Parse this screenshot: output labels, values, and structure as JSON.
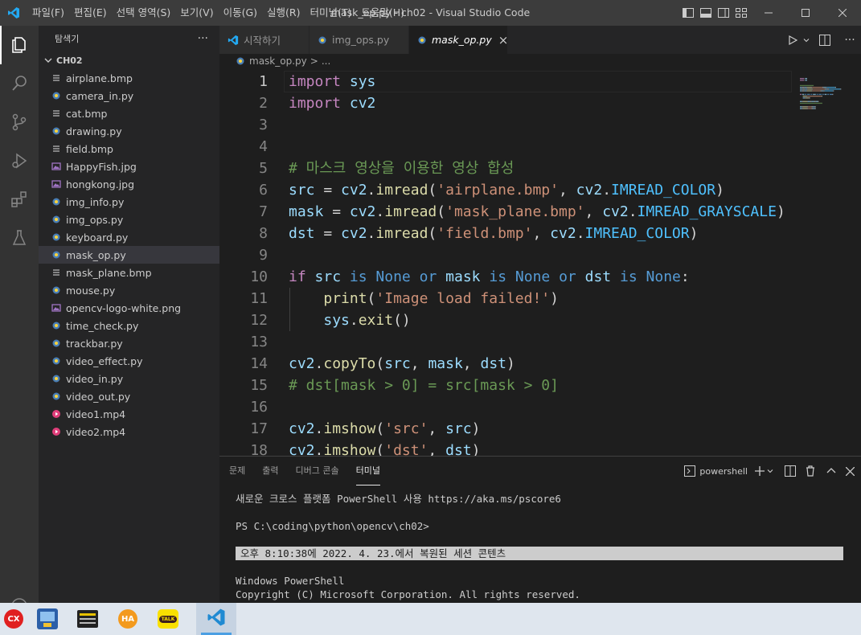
{
  "titlebar": {
    "menu": [
      "파일(F)",
      "편집(E)",
      "선택 영역(S)",
      "보기(V)",
      "이동(G)",
      "실행(R)",
      "터미널(T)",
      "도움말(H)"
    ],
    "title": "mask_op.py - ch02 - Visual Studio Code"
  },
  "sidebar": {
    "header": "탐색기",
    "more": "···",
    "folder": "CH02",
    "files": [
      {
        "name": "airplane.bmp",
        "icon": "bmp-file-icon"
      },
      {
        "name": "camera_in.py",
        "icon": "python-file-icon"
      },
      {
        "name": "cat.bmp",
        "icon": "bmp-file-icon"
      },
      {
        "name": "drawing.py",
        "icon": "python-file-icon"
      },
      {
        "name": "field.bmp",
        "icon": "bmp-file-icon"
      },
      {
        "name": "HappyFish.jpg",
        "icon": "image-file-icon"
      },
      {
        "name": "hongkong.jpg",
        "icon": "image-file-icon"
      },
      {
        "name": "img_info.py",
        "icon": "python-file-icon"
      },
      {
        "name": "img_ops.py",
        "icon": "python-file-icon"
      },
      {
        "name": "keyboard.py",
        "icon": "python-file-icon"
      },
      {
        "name": "mask_op.py",
        "icon": "python-file-icon",
        "selected": true
      },
      {
        "name": "mask_plane.bmp",
        "icon": "bmp-file-icon"
      },
      {
        "name": "mouse.py",
        "icon": "python-file-icon"
      },
      {
        "name": "opencv-logo-white.png",
        "icon": "image-file-icon"
      },
      {
        "name": "time_check.py",
        "icon": "python-file-icon"
      },
      {
        "name": "trackbar.py",
        "icon": "python-file-icon"
      },
      {
        "name": "video_effect.py",
        "icon": "python-file-icon"
      },
      {
        "name": "video_in.py",
        "icon": "python-file-icon"
      },
      {
        "name": "video_out.py",
        "icon": "python-file-icon"
      },
      {
        "name": "video1.mp4",
        "icon": "video-file-icon"
      },
      {
        "name": "video2.mp4",
        "icon": "video-file-icon"
      }
    ]
  },
  "tabs": [
    {
      "label": "시작하기",
      "icon": "vscode-icon"
    },
    {
      "label": "img_ops.py",
      "icon": "python-file-icon"
    },
    {
      "label": "mask_op.py",
      "icon": "python-file-icon",
      "active": true,
      "close": "×"
    }
  ],
  "breadcrumb": {
    "file": "mask_op.py",
    "sep": ">",
    "rest": "..."
  },
  "editor": {
    "line_numbers": [
      "1",
      "2",
      "3",
      "4",
      "5",
      "6",
      "7",
      "8",
      "9",
      "10",
      "11",
      "12",
      "13",
      "14",
      "15",
      "16",
      "17",
      "18"
    ],
    "lines": [
      [
        [
          "kw",
          "import"
        ],
        [
          "plain",
          " "
        ],
        [
          "var",
          "sys"
        ]
      ],
      [
        [
          "kw",
          "import"
        ],
        [
          "plain",
          " "
        ],
        [
          "var",
          "cv2"
        ]
      ],
      [],
      [],
      [
        [
          "cmt",
          "# 마스크 영상을 이용한 영상 합성"
        ]
      ],
      [
        [
          "var",
          "src"
        ],
        [
          "plain",
          " = "
        ],
        [
          "var",
          "cv2"
        ],
        [
          "plain",
          "."
        ],
        [
          "fn",
          "imread"
        ],
        [
          "plain",
          "("
        ],
        [
          "str",
          "'airplane.bmp'"
        ],
        [
          "plain",
          ", "
        ],
        [
          "var",
          "cv2"
        ],
        [
          "plain",
          "."
        ],
        [
          "enm",
          "IMREAD_COLOR"
        ],
        [
          "plain",
          ")"
        ]
      ],
      [
        [
          "var",
          "mask"
        ],
        [
          "plain",
          " = "
        ],
        [
          "var",
          "cv2"
        ],
        [
          "plain",
          "."
        ],
        [
          "fn",
          "imread"
        ],
        [
          "plain",
          "("
        ],
        [
          "str",
          "'mask_plane.bmp'"
        ],
        [
          "plain",
          ", "
        ],
        [
          "var",
          "cv2"
        ],
        [
          "plain",
          "."
        ],
        [
          "enm",
          "IMREAD_GRAYSCALE"
        ],
        [
          "plain",
          ")"
        ]
      ],
      [
        [
          "var",
          "dst"
        ],
        [
          "plain",
          " = "
        ],
        [
          "var",
          "cv2"
        ],
        [
          "plain",
          "."
        ],
        [
          "fn",
          "imread"
        ],
        [
          "plain",
          "("
        ],
        [
          "str",
          "'field.bmp'"
        ],
        [
          "plain",
          ", "
        ],
        [
          "var",
          "cv2"
        ],
        [
          "plain",
          "."
        ],
        [
          "enm",
          "IMREAD_COLOR"
        ],
        [
          "plain",
          ")"
        ]
      ],
      [],
      [
        [
          "kw",
          "if"
        ],
        [
          "plain",
          " "
        ],
        [
          "var",
          "src"
        ],
        [
          "plain",
          " "
        ],
        [
          "cst",
          "is"
        ],
        [
          "plain",
          " "
        ],
        [
          "cst",
          "None"
        ],
        [
          "plain",
          " "
        ],
        [
          "cst",
          "or"
        ],
        [
          "plain",
          " "
        ],
        [
          "var",
          "mask"
        ],
        [
          "plain",
          " "
        ],
        [
          "cst",
          "is"
        ],
        [
          "plain",
          " "
        ],
        [
          "cst",
          "None"
        ],
        [
          "plain",
          " "
        ],
        [
          "cst",
          "or"
        ],
        [
          "plain",
          " "
        ],
        [
          "var",
          "dst"
        ],
        [
          "plain",
          " "
        ],
        [
          "cst",
          "is"
        ],
        [
          "plain",
          " "
        ],
        [
          "cst",
          "None"
        ],
        [
          "plain",
          ":"
        ]
      ],
      [
        [
          "plain",
          "    "
        ],
        [
          "fn",
          "print"
        ],
        [
          "plain",
          "("
        ],
        [
          "str",
          "'Image load failed!'"
        ],
        [
          "plain",
          ")"
        ]
      ],
      [
        [
          "plain",
          "    "
        ],
        [
          "var",
          "sys"
        ],
        [
          "plain",
          "."
        ],
        [
          "fn",
          "exit"
        ],
        [
          "plain",
          "()"
        ]
      ],
      [],
      [
        [
          "var",
          "cv2"
        ],
        [
          "plain",
          "."
        ],
        [
          "fn",
          "copyTo"
        ],
        [
          "plain",
          "("
        ],
        [
          "var",
          "src"
        ],
        [
          "plain",
          ", "
        ],
        [
          "var",
          "mask"
        ],
        [
          "plain",
          ", "
        ],
        [
          "var",
          "dst"
        ],
        [
          "plain",
          ")"
        ]
      ],
      [
        [
          "cmt",
          "# dst[mask > 0] = src[mask > 0]"
        ]
      ],
      [],
      [
        [
          "var",
          "cv2"
        ],
        [
          "plain",
          "."
        ],
        [
          "fn",
          "imshow"
        ],
        [
          "plain",
          "("
        ],
        [
          "str",
          "'src'"
        ],
        [
          "plain",
          ", "
        ],
        [
          "var",
          "src"
        ],
        [
          "plain",
          ")"
        ]
      ],
      [
        [
          "var",
          "cv2"
        ],
        [
          "plain",
          "."
        ],
        [
          "fn",
          "imshow"
        ],
        [
          "plain",
          "("
        ],
        [
          "str",
          "'dst'"
        ],
        [
          "plain",
          ", "
        ],
        [
          "var",
          "dst"
        ],
        [
          "plain",
          ")"
        ]
      ]
    ]
  },
  "panel": {
    "tabs": [
      "문제",
      "출력",
      "디버그 콘솔",
      "터미널"
    ],
    "active_tab": "터미널",
    "shell": "powershell",
    "terminal": [
      {
        "text": "새로운 크로스 플랫폼 PowerShell 사용 https://aka.ms/pscore6",
        "hl": false
      },
      {
        "text": "",
        "hl": false
      },
      {
        "text": "PS C:\\coding\\python\\opencv\\ch02>",
        "hl": false
      },
      {
        "text": "",
        "hl": false
      },
      {
        "text": "오후 8:10:38에 2022. 4. 23.에서 복원된 세션 콘텐츠",
        "hl": true
      },
      {
        "text": "",
        "hl": false
      },
      {
        "text": "Windows PowerShell",
        "hl": false
      },
      {
        "text": "Copyright (C) Microsoft Corporation. All rights reserved.",
        "hl": false
      }
    ]
  },
  "taskbar": {
    "cx_label": "CX",
    "ha_label": "HA",
    "talk_label": "TALK"
  },
  "colors": {
    "accent": "#007acc",
    "keyword": "#c586c0",
    "string": "#ce9178",
    "function": "#dcdcaa",
    "variable": "#9cdcfe",
    "comment": "#6a9955"
  }
}
